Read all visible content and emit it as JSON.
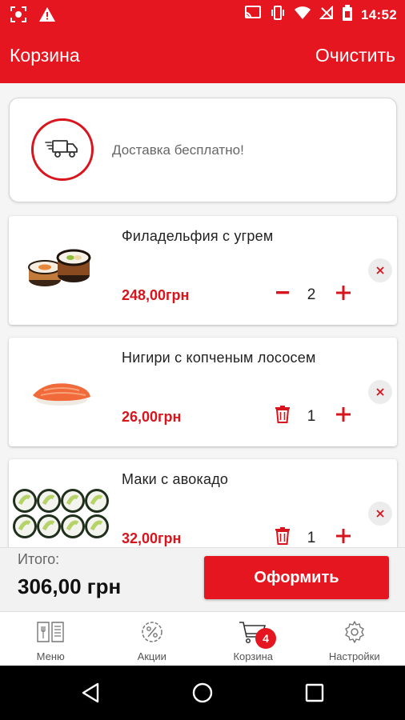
{
  "status_bar": {
    "time": "14:52"
  },
  "app_bar": {
    "title": "Корзина",
    "clear_label": "Очистить"
  },
  "delivery": {
    "text": "Доставка бесплатно!"
  },
  "cart_items": [
    {
      "name": "Филадельфия с угрем",
      "price": "248,00грн",
      "quantity": "2",
      "decrement_icon": "minus-icon"
    },
    {
      "name": "Нигири с копченым лососем",
      "price": "26,00грн",
      "quantity": "1",
      "decrement_icon": "trash-icon"
    },
    {
      "name": "Маки с авокадо",
      "price": "32,00грн",
      "quantity": "1",
      "decrement_icon": "trash-icon"
    }
  ],
  "total": {
    "label": "Итого:",
    "value": "306,00 грн"
  },
  "checkout": {
    "label": "Оформить"
  },
  "bottom_nav": {
    "items": [
      {
        "label": "Меню",
        "icon": "menu-book-icon"
      },
      {
        "label": "Акции",
        "icon": "percent-icon"
      },
      {
        "label": "Корзина",
        "icon": "cart-icon",
        "badge": "4"
      },
      {
        "label": "Настройки",
        "icon": "gear-icon"
      }
    ]
  },
  "colors": {
    "accent": "#e5161f",
    "price": "#d8141c"
  }
}
